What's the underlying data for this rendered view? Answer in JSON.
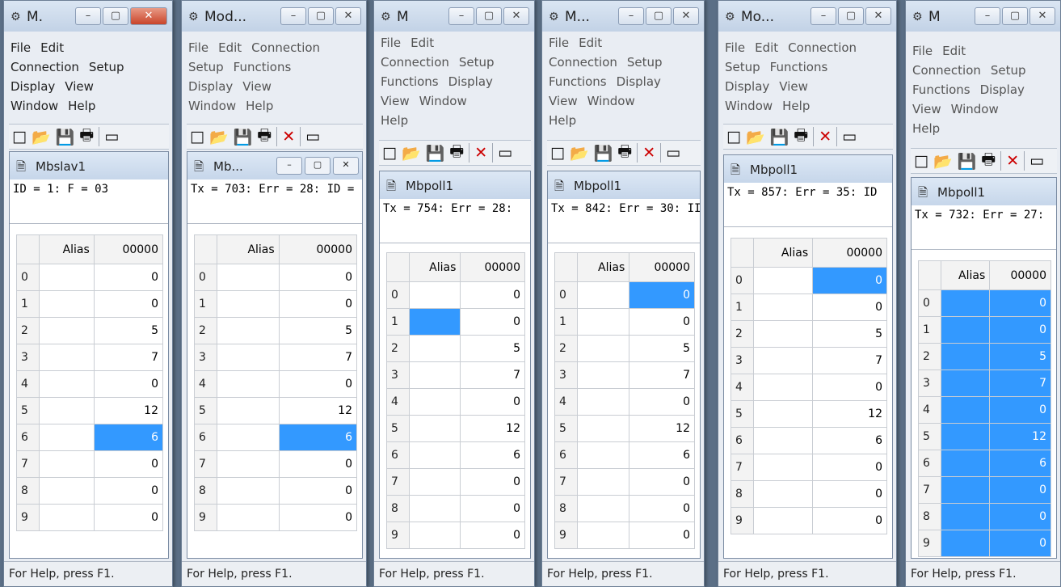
{
  "windows": [
    {
      "title": "M.",
      "app_icon": "slave-icon",
      "menu_rows": [
        [
          "File",
          "Edit"
        ],
        [
          "Connection",
          "Setup"
        ],
        [
          "Display",
          "View"
        ],
        [
          "Window",
          "Help"
        ]
      ],
      "toolbar_delete": false,
      "child_title": "Mbslav1",
      "child_has_buttons": false,
      "status_line": "ID = 1: F = 03",
      "col_header": "00000",
      "alias_header": "Alias",
      "rows": [
        {
          "n": "0",
          "v": "0"
        },
        {
          "n": "1",
          "v": "0"
        },
        {
          "n": "2",
          "v": "5"
        },
        {
          "n": "3",
          "v": "7"
        },
        {
          "n": "4",
          "v": "0"
        },
        {
          "n": "5",
          "v": "12"
        },
        {
          "n": "6",
          "v": "6",
          "sel_val": true
        },
        {
          "n": "7",
          "v": "0"
        },
        {
          "n": "8",
          "v": "0"
        },
        {
          "n": "9",
          "v": "0"
        }
      ],
      "status": "For Help, press F1."
    },
    {
      "title": "Mod...",
      "app_icon": "modbus-icon",
      "menu_rows": [
        [
          "File",
          "Edit",
          "Connection"
        ],
        [
          "Setup",
          "Functions"
        ],
        [
          "Display",
          "View"
        ],
        [
          "Window",
          "Help"
        ]
      ],
      "toolbar_delete": true,
      "child_title": "Mb...",
      "child_has_buttons": true,
      "status_line": "Tx = 703: Err = 28: ID =",
      "col_header": "00000",
      "alias_header": "Alias",
      "rows": [
        {
          "n": "0",
          "v": "0"
        },
        {
          "n": "1",
          "v": "0"
        },
        {
          "n": "2",
          "v": "5"
        },
        {
          "n": "3",
          "v": "7"
        },
        {
          "n": "4",
          "v": "0"
        },
        {
          "n": "5",
          "v": "12"
        },
        {
          "n": "6",
          "v": "6",
          "sel_val": true
        },
        {
          "n": "7",
          "v": "0"
        },
        {
          "n": "8",
          "v": "0"
        },
        {
          "n": "9",
          "v": "0"
        }
      ],
      "status": "For Help, press F1."
    },
    {
      "title": "M",
      "app_icon": "modbus-icon",
      "menu_rows": [
        [
          "File",
          "Edit"
        ],
        [
          "Connection",
          "Setup"
        ],
        [
          "Functions",
          "Display"
        ],
        [
          "View",
          "Window"
        ],
        [
          "Help"
        ]
      ],
      "toolbar_delete": true,
      "child_title": "Mbpoll1",
      "child_has_buttons": false,
      "status_line": "Tx = 754: Err = 28:",
      "col_header": "00000",
      "alias_header": "Alias",
      "rows": [
        {
          "n": "0",
          "v": "0"
        },
        {
          "n": "1",
          "v": "0",
          "sel_alias": true
        },
        {
          "n": "2",
          "v": "5"
        },
        {
          "n": "3",
          "v": "7"
        },
        {
          "n": "4",
          "v": "0"
        },
        {
          "n": "5",
          "v": "12"
        },
        {
          "n": "6",
          "v": "6"
        },
        {
          "n": "7",
          "v": "0"
        },
        {
          "n": "8",
          "v": "0"
        },
        {
          "n": "9",
          "v": "0"
        }
      ],
      "status": "For Help, press F1."
    },
    {
      "title": "M...",
      "app_icon": "modbus-icon",
      "menu_rows": [
        [
          "File",
          "Edit"
        ],
        [
          "Connection",
          "Setup"
        ],
        [
          "Functions",
          "Display"
        ],
        [
          "View",
          "Window"
        ],
        [
          "Help"
        ]
      ],
      "toolbar_delete": true,
      "child_title": "Mbpoll1",
      "child_has_buttons": false,
      "status_line": "Tx = 842: Err = 30: II",
      "col_header": "00000",
      "alias_header": "Alias",
      "rows": [
        {
          "n": "0",
          "v": "0",
          "sel_val": true
        },
        {
          "n": "1",
          "v": "0"
        },
        {
          "n": "2",
          "v": "5"
        },
        {
          "n": "3",
          "v": "7"
        },
        {
          "n": "4",
          "v": "0"
        },
        {
          "n": "5",
          "v": "12"
        },
        {
          "n": "6",
          "v": "6"
        },
        {
          "n": "7",
          "v": "0"
        },
        {
          "n": "8",
          "v": "0"
        },
        {
          "n": "9",
          "v": "0"
        }
      ],
      "status": "For Help, press F1."
    },
    {
      "title": "Mo...",
      "app_icon": "modbus-icon",
      "menu_rows": [
        [
          "File",
          "Edit",
          "Connection"
        ],
        [
          "Setup",
          "Functions"
        ],
        [
          "Display",
          "View"
        ],
        [
          "Window",
          "Help"
        ]
      ],
      "toolbar_delete": true,
      "child_title": "Mbpoll1",
      "child_has_buttons": false,
      "status_line": "Tx = 857: Err = 35: ID",
      "col_header": "00000",
      "alias_header": "Alias",
      "rows": [
        {
          "n": "0",
          "v": "0",
          "sel_val": true
        },
        {
          "n": "1",
          "v": "0"
        },
        {
          "n": "2",
          "v": "5"
        },
        {
          "n": "3",
          "v": "7"
        },
        {
          "n": "4",
          "v": "0"
        },
        {
          "n": "5",
          "v": "12"
        },
        {
          "n": "6",
          "v": "6"
        },
        {
          "n": "7",
          "v": "0"
        },
        {
          "n": "8",
          "v": "0"
        },
        {
          "n": "9",
          "v": "0"
        }
      ],
      "status": "For Help, press F1."
    },
    {
      "title": "M",
      "app_icon": "modbus-icon",
      "menu_rows": [
        [
          "File",
          "Edit"
        ],
        [
          "Connection",
          "Setup"
        ],
        [
          "Functions",
          "Display"
        ],
        [
          "View",
          "Window"
        ],
        [
          "Help"
        ]
      ],
      "toolbar_delete": true,
      "child_title": "Mbpoll1",
      "child_has_buttons": false,
      "status_line": "Tx = 732: Err = 27:",
      "col_header": "00000",
      "alias_header": "Alias",
      "rows": [
        {
          "n": "0",
          "v": "0",
          "sel_alias": true,
          "sel_val": true
        },
        {
          "n": "1",
          "v": "0",
          "sel_alias": true,
          "sel_val": true
        },
        {
          "n": "2",
          "v": "5",
          "sel_alias": true,
          "sel_val": true
        },
        {
          "n": "3",
          "v": "7",
          "sel_alias": true,
          "sel_val": true
        },
        {
          "n": "4",
          "v": "0",
          "sel_alias": true,
          "sel_val": true
        },
        {
          "n": "5",
          "v": "12",
          "sel_alias": true,
          "sel_val": true
        },
        {
          "n": "6",
          "v": "6",
          "sel_alias": true,
          "sel_val": true
        },
        {
          "n": "7",
          "v": "0",
          "sel_alias": true,
          "sel_val": true
        },
        {
          "n": "8",
          "v": "0",
          "sel_alias": true,
          "sel_val": true
        },
        {
          "n": "9",
          "v": "0",
          "sel_alias": true,
          "sel_val": true
        }
      ],
      "status": "For Help, press F1."
    }
  ],
  "colors": {
    "selection": "#3399ff",
    "desktop": "#5b6f86"
  }
}
